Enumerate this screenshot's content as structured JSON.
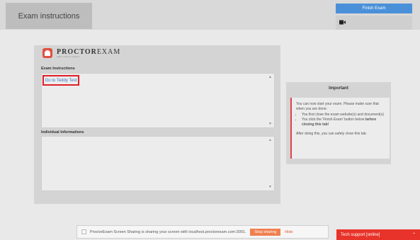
{
  "header": {
    "title": "Exam instructions",
    "finish_button": "Finish Exam",
    "camera_icon": "video-camera-icon"
  },
  "logo": {
    "name_bold": "PROCTOR",
    "name_regular": "EXAM",
    "tagline": "safe online exams",
    "icon": "proctorexam-logo-icon"
  },
  "exam_instructions": {
    "label": "Exam Instructions",
    "link_text": "Go to Teddy Test"
  },
  "individual_informations": {
    "label": "Individual Informations"
  },
  "important": {
    "title": "Important",
    "intro": "You can now start your exam. Please make sure that when you are done:",
    "items": [
      "You first close the exam website(s) and document(s)",
      "You click the 'Finish Exam' button below"
    ],
    "bold_item_suffix": "before closing this tab!",
    "after": "After doing this, you can safely close this tab."
  },
  "share_bar": {
    "message": "ProctorExam Screen Sharing is sharing your screen with localhost.proctorexam.com:3001.",
    "stop_button": "Stop sharing",
    "hide_link": "Hide"
  },
  "tech_support": {
    "label": "Tech support [online]",
    "chevron_icon": "chevron-up-icon"
  },
  "colors": {
    "finish_button": "#4a90d9",
    "highlight_border": "#e0202a",
    "tech_support": "#e8332a",
    "stop_sharing": "#f07f50",
    "link": "#3a76c8"
  }
}
